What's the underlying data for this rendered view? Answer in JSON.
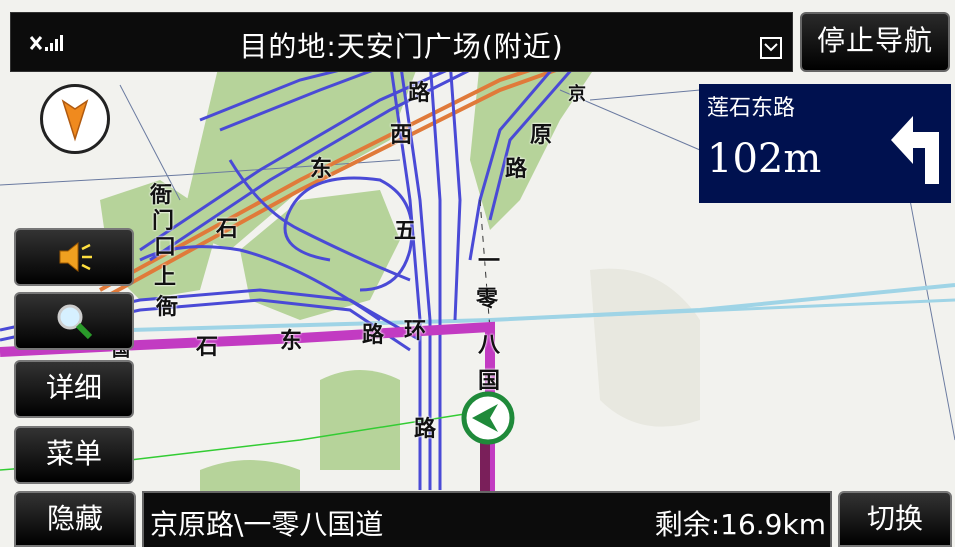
{
  "topbar": {
    "signal_icon": "gps-signal-icon",
    "destination": "目的地:天安门广场(附近)",
    "dropdown_icon": "dropdown-icon",
    "stop_label": "停止导航"
  },
  "turn": {
    "next_road": "莲石东路",
    "distance": "102m",
    "direction_icon": "turn-left-arrow-icon"
  },
  "left_buttons": {
    "volume_icon": "speaker-icon",
    "zoom_icon": "magnifier-icon",
    "detail_label": "详细",
    "menu_label": "菜单"
  },
  "bottom": {
    "hide_label": "隐藏",
    "current_road": "京原路\\一零八国道",
    "remaining": "剩余:16.9km",
    "switch_label": "切换"
  },
  "map_labels": {
    "l1": "路",
    "l2": "京",
    "l3": "西",
    "l4": "原",
    "l5": "东",
    "l6": "路",
    "l7": "衙",
    "l8": "门",
    "l9": "口",
    "l10": "上",
    "l11": "石",
    "l12": "五",
    "l13": "一",
    "l14": "衙",
    "l15": "零",
    "l16": "石",
    "l17": "东",
    "l18": "路",
    "l19": "环",
    "l20": "八",
    "l21": "国",
    "l22": "路",
    "l23": "国"
  },
  "colors": {
    "route": "#c23bc2",
    "road_blue": "#4a4ad6",
    "railway": "#e07a3a",
    "green_area": "#b6d39a",
    "panel": "#00114f"
  }
}
